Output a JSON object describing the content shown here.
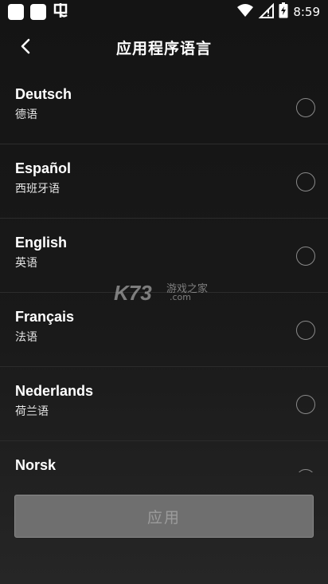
{
  "status_bar": {
    "time": "8:59",
    "left_icons": [
      "notification-square-icon",
      "notification-square-icon",
      "app-notification-icon"
    ],
    "right_icons": [
      "wifi-icon",
      "no-sim-icon",
      "battery-icon"
    ]
  },
  "header": {
    "title": "应用程序语言",
    "back_icon": "chevron-left-icon"
  },
  "languages": [
    {
      "name": "Deutsch",
      "native": "德语"
    },
    {
      "name": "Español",
      "native": "西班牙语"
    },
    {
      "name": "English",
      "native": "英语"
    },
    {
      "name": "Français",
      "native": "法语"
    },
    {
      "name": "Nederlands",
      "native": "荷兰语"
    },
    {
      "name": "Norsk",
      "native": ""
    }
  ],
  "watermark": {
    "brand": "K73",
    "site_cn": "游戏之家",
    "domain": ".com"
  },
  "footer": {
    "apply_label": "应用",
    "apply_enabled": false
  },
  "colors": {
    "background": "#161616",
    "divider": "#2c2c2c",
    "radio_border": "#8a8a8a",
    "button_disabled": "#6f6f6f"
  }
}
